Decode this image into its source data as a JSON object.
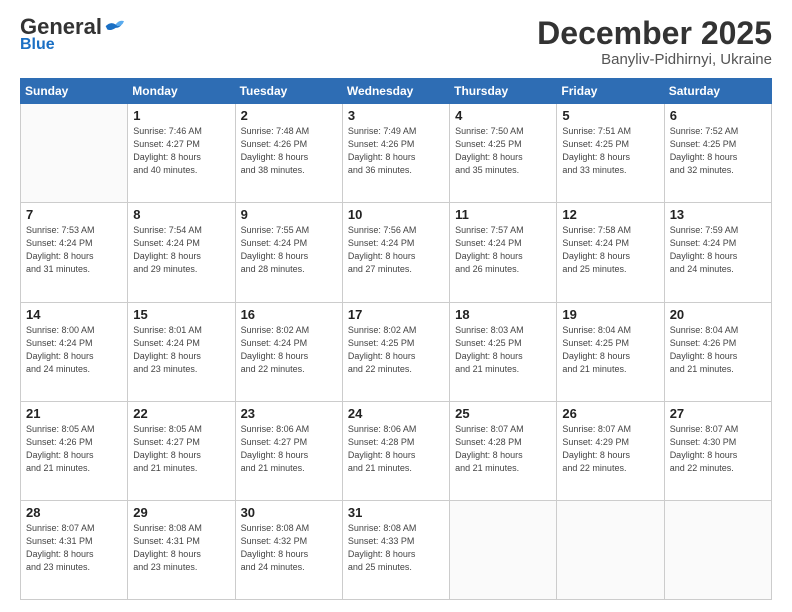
{
  "logo": {
    "general": "General",
    "blue": "Blue"
  },
  "header": {
    "month": "December 2025",
    "location": "Banyliv-Pidhirnyi, Ukraine"
  },
  "weekdays": [
    "Sunday",
    "Monday",
    "Tuesday",
    "Wednesday",
    "Thursday",
    "Friday",
    "Saturday"
  ],
  "weeks": [
    [
      {
        "day": "",
        "info": ""
      },
      {
        "day": "1",
        "info": "Sunrise: 7:46 AM\nSunset: 4:27 PM\nDaylight: 8 hours\nand 40 minutes."
      },
      {
        "day": "2",
        "info": "Sunrise: 7:48 AM\nSunset: 4:26 PM\nDaylight: 8 hours\nand 38 minutes."
      },
      {
        "day": "3",
        "info": "Sunrise: 7:49 AM\nSunset: 4:26 PM\nDaylight: 8 hours\nand 36 minutes."
      },
      {
        "day": "4",
        "info": "Sunrise: 7:50 AM\nSunset: 4:25 PM\nDaylight: 8 hours\nand 35 minutes."
      },
      {
        "day": "5",
        "info": "Sunrise: 7:51 AM\nSunset: 4:25 PM\nDaylight: 8 hours\nand 33 minutes."
      },
      {
        "day": "6",
        "info": "Sunrise: 7:52 AM\nSunset: 4:25 PM\nDaylight: 8 hours\nand 32 minutes."
      }
    ],
    [
      {
        "day": "7",
        "info": "Sunrise: 7:53 AM\nSunset: 4:24 PM\nDaylight: 8 hours\nand 31 minutes."
      },
      {
        "day": "8",
        "info": "Sunrise: 7:54 AM\nSunset: 4:24 PM\nDaylight: 8 hours\nand 29 minutes."
      },
      {
        "day": "9",
        "info": "Sunrise: 7:55 AM\nSunset: 4:24 PM\nDaylight: 8 hours\nand 28 minutes."
      },
      {
        "day": "10",
        "info": "Sunrise: 7:56 AM\nSunset: 4:24 PM\nDaylight: 8 hours\nand 27 minutes."
      },
      {
        "day": "11",
        "info": "Sunrise: 7:57 AM\nSunset: 4:24 PM\nDaylight: 8 hours\nand 26 minutes."
      },
      {
        "day": "12",
        "info": "Sunrise: 7:58 AM\nSunset: 4:24 PM\nDaylight: 8 hours\nand 25 minutes."
      },
      {
        "day": "13",
        "info": "Sunrise: 7:59 AM\nSunset: 4:24 PM\nDaylight: 8 hours\nand 24 minutes."
      }
    ],
    [
      {
        "day": "14",
        "info": "Sunrise: 8:00 AM\nSunset: 4:24 PM\nDaylight: 8 hours\nand 24 minutes."
      },
      {
        "day": "15",
        "info": "Sunrise: 8:01 AM\nSunset: 4:24 PM\nDaylight: 8 hours\nand 23 minutes."
      },
      {
        "day": "16",
        "info": "Sunrise: 8:02 AM\nSunset: 4:24 PM\nDaylight: 8 hours\nand 22 minutes."
      },
      {
        "day": "17",
        "info": "Sunrise: 8:02 AM\nSunset: 4:25 PM\nDaylight: 8 hours\nand 22 minutes."
      },
      {
        "day": "18",
        "info": "Sunrise: 8:03 AM\nSunset: 4:25 PM\nDaylight: 8 hours\nand 21 minutes."
      },
      {
        "day": "19",
        "info": "Sunrise: 8:04 AM\nSunset: 4:25 PM\nDaylight: 8 hours\nand 21 minutes."
      },
      {
        "day": "20",
        "info": "Sunrise: 8:04 AM\nSunset: 4:26 PM\nDaylight: 8 hours\nand 21 minutes."
      }
    ],
    [
      {
        "day": "21",
        "info": "Sunrise: 8:05 AM\nSunset: 4:26 PM\nDaylight: 8 hours\nand 21 minutes."
      },
      {
        "day": "22",
        "info": "Sunrise: 8:05 AM\nSunset: 4:27 PM\nDaylight: 8 hours\nand 21 minutes."
      },
      {
        "day": "23",
        "info": "Sunrise: 8:06 AM\nSunset: 4:27 PM\nDaylight: 8 hours\nand 21 minutes."
      },
      {
        "day": "24",
        "info": "Sunrise: 8:06 AM\nSunset: 4:28 PM\nDaylight: 8 hours\nand 21 minutes."
      },
      {
        "day": "25",
        "info": "Sunrise: 8:07 AM\nSunset: 4:28 PM\nDaylight: 8 hours\nand 21 minutes."
      },
      {
        "day": "26",
        "info": "Sunrise: 8:07 AM\nSunset: 4:29 PM\nDaylight: 8 hours\nand 22 minutes."
      },
      {
        "day": "27",
        "info": "Sunrise: 8:07 AM\nSunset: 4:30 PM\nDaylight: 8 hours\nand 22 minutes."
      }
    ],
    [
      {
        "day": "28",
        "info": "Sunrise: 8:07 AM\nSunset: 4:31 PM\nDaylight: 8 hours\nand 23 minutes."
      },
      {
        "day": "29",
        "info": "Sunrise: 8:08 AM\nSunset: 4:31 PM\nDaylight: 8 hours\nand 23 minutes."
      },
      {
        "day": "30",
        "info": "Sunrise: 8:08 AM\nSunset: 4:32 PM\nDaylight: 8 hours\nand 24 minutes."
      },
      {
        "day": "31",
        "info": "Sunrise: 8:08 AM\nSunset: 4:33 PM\nDaylight: 8 hours\nand 25 minutes."
      },
      {
        "day": "",
        "info": ""
      },
      {
        "day": "",
        "info": ""
      },
      {
        "day": "",
        "info": ""
      }
    ]
  ]
}
